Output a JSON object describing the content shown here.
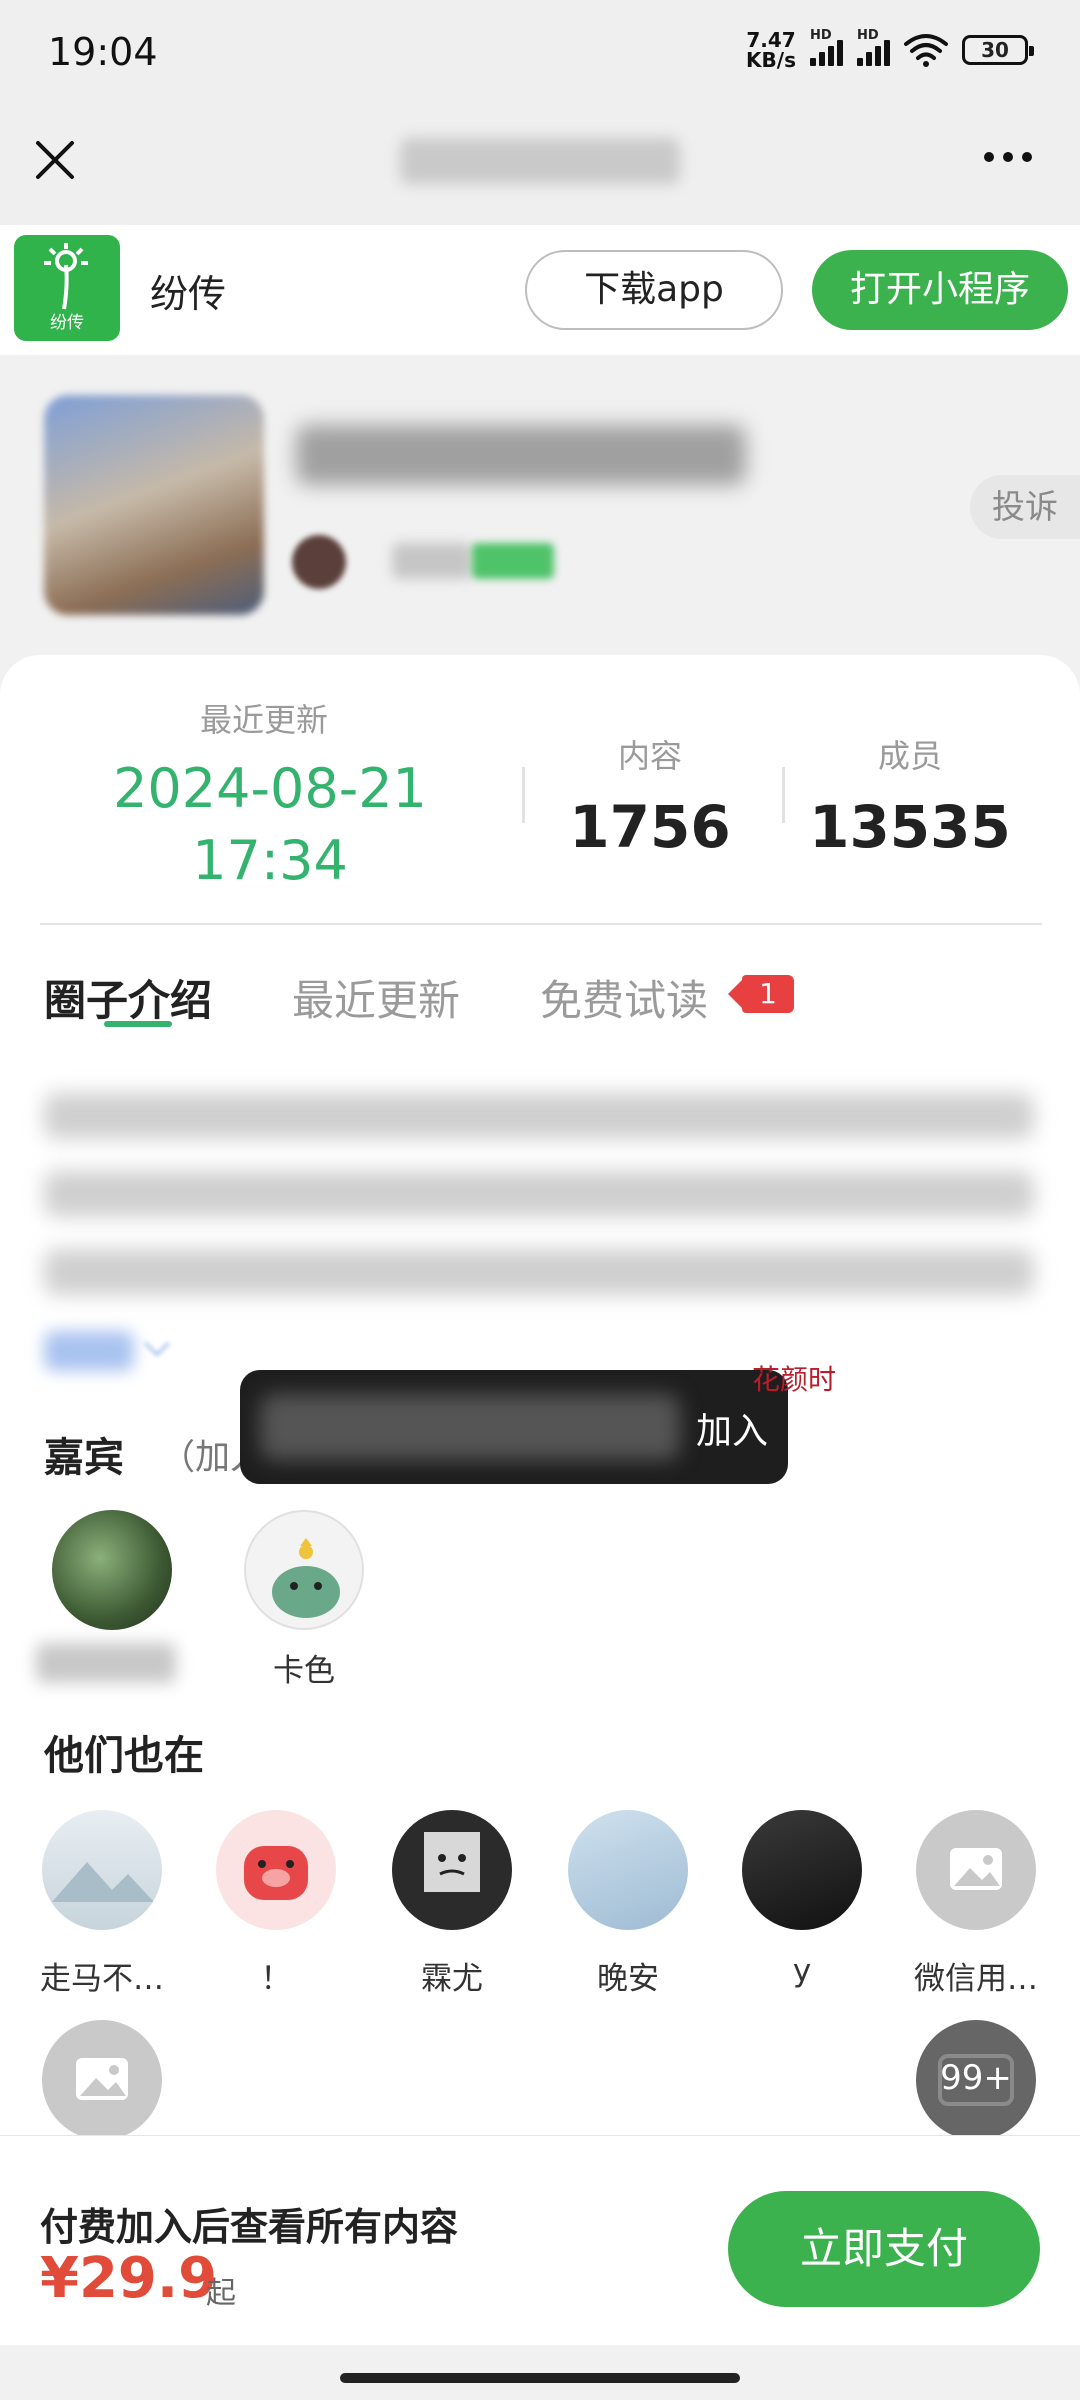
{
  "status": {
    "time": "19:04",
    "net_speed_value": "7.47",
    "net_speed_unit": "KB/s",
    "hd_1": "HD",
    "hd_2": "HD",
    "battery": "30"
  },
  "navbar": {
    "close_icon": "close-icon",
    "more_icon": "more-icon"
  },
  "app": {
    "name": "纷传",
    "logo_text": "纷传",
    "download_label": "下载app",
    "open_label": "打开小程序"
  },
  "group": {
    "complaint_label": "投诉"
  },
  "stats": {
    "update_label": "最近更新",
    "update_date": "2024-08-21",
    "update_time": "17:34",
    "content_label": "内容",
    "content_value": "1756",
    "members_label": "成员",
    "members_value": "13535"
  },
  "tabs": [
    {
      "label": "圈子介绍"
    },
    {
      "label": "最近更新"
    },
    {
      "label": "免费试读"
    }
  ],
  "tab_badge": "1",
  "guests": {
    "title": "嘉宾",
    "subtitle": "（加入后可向他们提问）",
    "second_name": "卡色"
  },
  "members": {
    "title": "他们也在",
    "row1": [
      {
        "name": "走马不…"
      },
      {
        "name": "！"
      },
      {
        "name": "霖尤"
      },
      {
        "name": "晚安"
      },
      {
        "name": "y"
      },
      {
        "name": "微信用…"
      }
    ],
    "more_count": "99+"
  },
  "toast": {
    "text": "加入",
    "side_text": "花颜时"
  },
  "bottom": {
    "text": "付费加入后查看所有内容",
    "price": "¥29.9",
    "price_suffix": "起",
    "pay_label": "立即支付"
  },
  "colors": {
    "accent": "#3bb24e",
    "stat_green": "#33b36e",
    "price": "#e14b3a",
    "badge": "#e84040"
  }
}
